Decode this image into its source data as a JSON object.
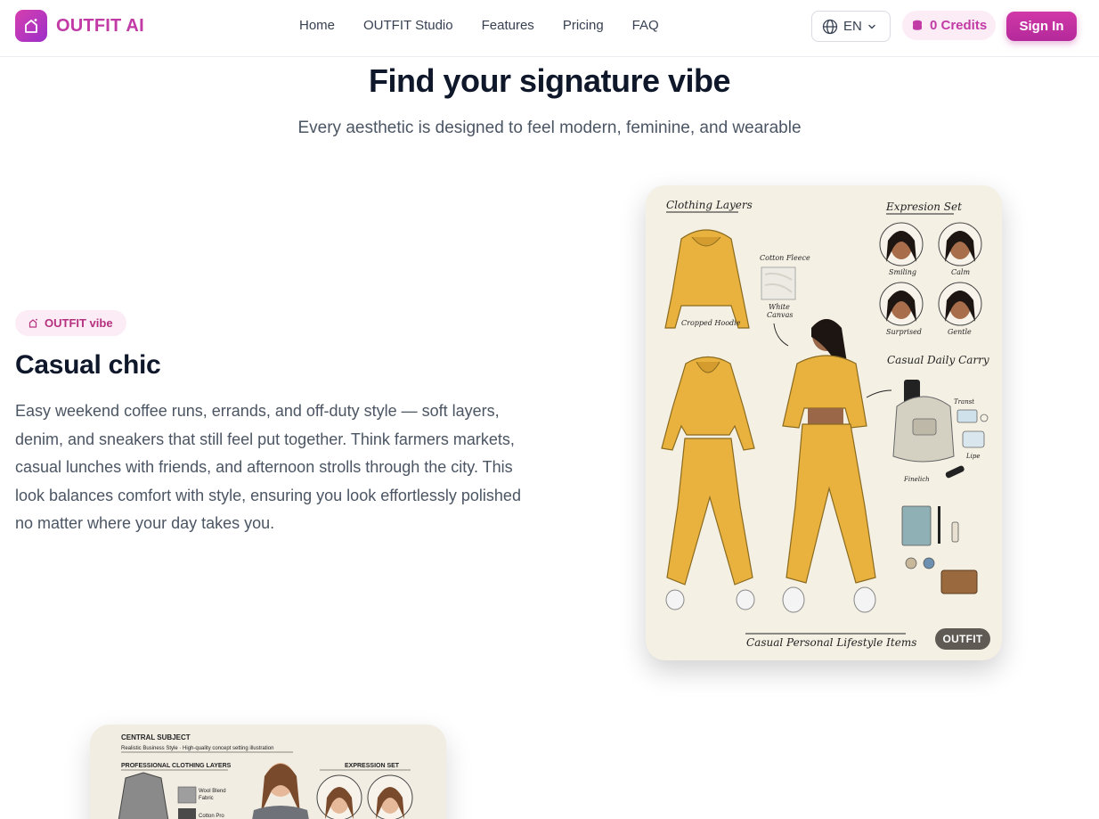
{
  "brand": {
    "name": "OUTFIT AI"
  },
  "nav": {
    "items": [
      "Home",
      "OUTFIT Studio",
      "Features",
      "Pricing",
      "FAQ"
    ]
  },
  "header": {
    "language": "EN",
    "credits": "0 Credits",
    "sign_in": "Sign In"
  },
  "hero": {
    "title": "Find your signature vibe",
    "subtitle": "Every aesthetic is designed to feel modern, feminine, and wearable"
  },
  "vibe": {
    "badge": "OUTFIT vibe",
    "title": "Casual chic",
    "description": "Easy weekend coffee runs, errands, and off-duty style — soft layers, denim, and sneakers that still feel put together. Think farmers markets, casual lunches with friends, and afternoon strolls through the city. This look balances comfort with style, ensuring you look effortlessly polished no matter where your day takes you."
  },
  "card1": {
    "tag": "OUTFIT",
    "sections": {
      "clothing_layers": "Clothing Layers",
      "expression_set": "Expresion Set",
      "daily_carry": "Casual Daily Carry",
      "footer": "Casual Personal Lifestyle Items"
    },
    "labels": {
      "cotton_fleece": "Cotton Fleece",
      "white": "White",
      "canvas": "Canvas",
      "cropped_hoodie": "Cropped Hoodie",
      "transit": "Transt",
      "lipe": "Lipe",
      "finlich": "Finelich"
    },
    "expressions": [
      "Smiling",
      "Calm",
      "Surprised",
      "Gentle"
    ]
  },
  "card2": {
    "central": "CENTRAL SUBJECT",
    "central_sub": "Realistic Business Style · High-quality concept setting illustration",
    "layers": "PROFESSIONAL CLOTHING LAYERS",
    "wool": "Wool Blend",
    "fabric": "Fabric",
    "cotton": "Cotton Pro",
    "expression": "EXPRESSION SET"
  },
  "colors": {
    "accent": "#c13aa6",
    "hoodie": "#e9b23f",
    "card_bg": "#f4f0e4"
  }
}
